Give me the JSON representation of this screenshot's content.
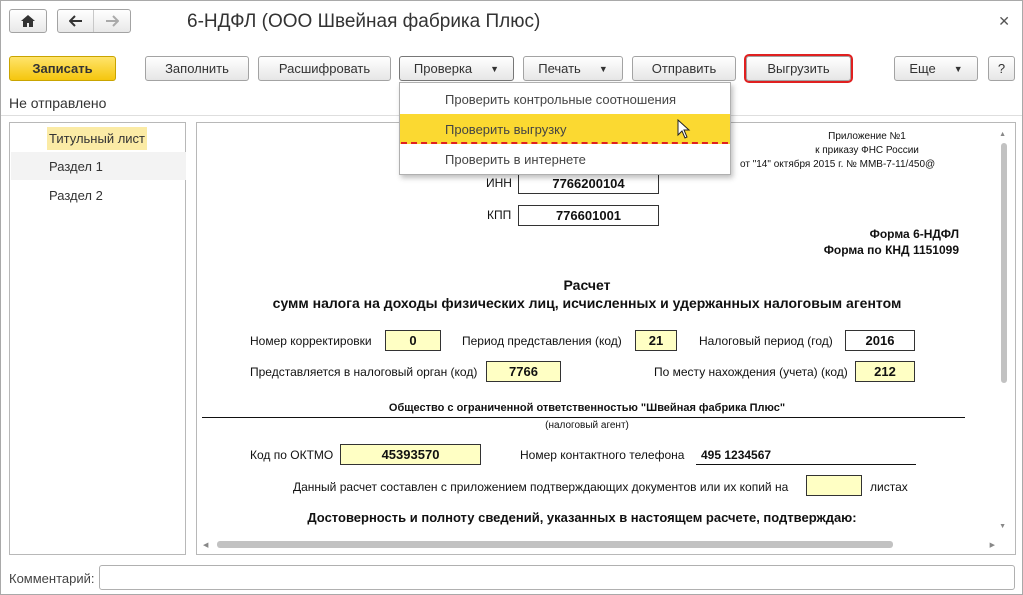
{
  "window": {
    "title": "6-НДФЛ (ООО Швейная фабрика Плюс)"
  },
  "toolbar": {
    "save": "Записать",
    "fill": "Заполнить",
    "decode": "Расшифровать",
    "check": "Проверка",
    "print": "Печать",
    "send": "Отправить",
    "upload": "Выгрузить",
    "more": "Еще",
    "help": "?"
  },
  "status": "Не отправлено",
  "sections": [
    {
      "label": "Титульный лист",
      "selected": true
    },
    {
      "label": "Раздел 1"
    },
    {
      "label": "Раздел 2"
    }
  ],
  "check_menu": {
    "items": [
      {
        "label": "Проверить контрольные соотношения"
      },
      {
        "label": "Проверить выгрузку",
        "highlighted": true
      },
      {
        "label": "Проверить в интернете"
      }
    ]
  },
  "doc": {
    "appendix_1": "Приложение №1",
    "appendix_2": "к приказу ФНС России",
    "appendix_3": "от \"14\" октября 2015 г. № ММВ-7-11/450@",
    "inn_label": "ИНН",
    "inn": "7766200104",
    "kpp_label": "КПП",
    "kpp": "776601001",
    "form_name": "Форма 6-НДФЛ",
    "form_knd": "Форма по КНД 1151099",
    "calc_title": "Расчет",
    "calc_subtitle": "сумм налога на доходы физических лиц, исчисленных и удержанных налоговым агентом",
    "correction_label": "Номер корректировки",
    "correction": "0",
    "period_label": "Период представления (код)",
    "period": "21",
    "tax_period_label": "Налоговый период (год)",
    "tax_period": "2016",
    "authority_label": "Представляется в налоговый орган (код)",
    "authority": "7766",
    "location_label": "По месту нахождения (учета) (код)",
    "location": "212",
    "agent_name": "Общество с ограниченной ответственностью \"Швейная фабрика Плюс\"",
    "agent_caption": "(налоговый агент)",
    "oktmo_label": "Код по ОКТМО",
    "oktmo": "45393570",
    "phone_label": "Номер контактного телефона",
    "phone": "495 1234567",
    "pages_text": "Данный расчет составлен с приложением подтверждающих документов или их копий на",
    "pages_value": "",
    "pages_suffix": "листах",
    "confirm_text": "Достоверность и полноту сведений, указанных в настоящем расчете, подтверждаю:"
  },
  "comment": {
    "label": "Комментарий:",
    "value": ""
  }
}
